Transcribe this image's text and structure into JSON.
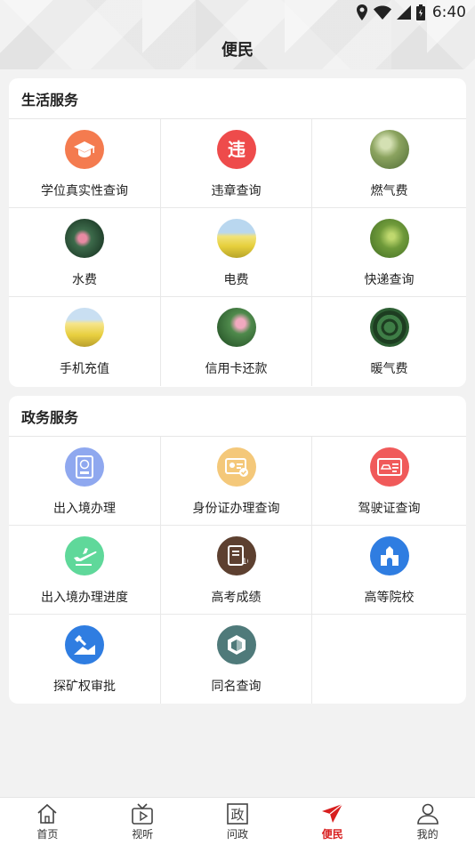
{
  "status": {
    "time": "6:40"
  },
  "page": {
    "title": "便民"
  },
  "sections": [
    {
      "title": "生活服务",
      "items": [
        {
          "label": "学位真实性查询",
          "icon": "graduation-cap-icon",
          "color": "#f47b4f"
        },
        {
          "label": "违章查询",
          "icon": "violation-icon",
          "color": "#ee4b4b"
        },
        {
          "label": "燃气费",
          "icon": "gas-photo-icon"
        },
        {
          "label": "水费",
          "icon": "water-photo-icon"
        },
        {
          "label": "电费",
          "icon": "electricity-photo-icon"
        },
        {
          "label": "快递查询",
          "icon": "express-photo-icon"
        },
        {
          "label": "手机充值",
          "icon": "phone-topup-photo-icon"
        },
        {
          "label": "信用卡还款",
          "icon": "credit-card-photo-icon"
        },
        {
          "label": "暖气费",
          "icon": "heating-photo-icon"
        }
      ]
    },
    {
      "title": "政务服务",
      "items": [
        {
          "label": "出入境办理",
          "icon": "passport-icon",
          "color": "#8fa8ef"
        },
        {
          "label": "身份证办理查询",
          "icon": "id-card-icon",
          "color": "#f4c87a"
        },
        {
          "label": "驾驶证查询",
          "icon": "driver-license-icon",
          "color": "#f05a5a"
        },
        {
          "label": "出入境办理进度",
          "icon": "airplane-icon",
          "color": "#5fd89a"
        },
        {
          "label": "高考成绩",
          "icon": "exam-score-icon",
          "color": "#5d4030"
        },
        {
          "label": "高等院校",
          "icon": "university-icon",
          "color": "#2f7de1"
        },
        {
          "label": "探矿权审批",
          "icon": "mining-icon",
          "color": "#2f7de1"
        },
        {
          "label": "同名查询",
          "icon": "same-name-icon",
          "color": "#4f7a7a"
        }
      ]
    }
  ],
  "tabbar": [
    {
      "label": "首页",
      "icon": "home-icon"
    },
    {
      "label": "视听",
      "icon": "tv-icon"
    },
    {
      "label": "问政",
      "icon": "gov-icon",
      "glyph": "政"
    },
    {
      "label": "便民",
      "icon": "paper-plane-icon",
      "active": true
    },
    {
      "label": "我的",
      "icon": "user-icon"
    }
  ],
  "colors": {
    "active": "#d81e1e",
    "divider": "#e6e6e6"
  }
}
